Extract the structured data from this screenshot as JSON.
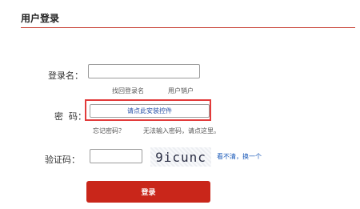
{
  "page": {
    "title": "用户登录"
  },
  "username": {
    "label": "登录名：",
    "value": "",
    "links": {
      "find": "找回登录名",
      "cancel": "用户销户"
    }
  },
  "password": {
    "label": "密  码：",
    "install_button": "请点此安装控件",
    "links": {
      "forgot": "忘记密码？",
      "cannot_input": "无法输入密码，请点这里。"
    }
  },
  "captcha": {
    "label": "验证码：",
    "value": "",
    "image_text": "9icunc",
    "refresh_link": "看不清，换一个"
  },
  "login_button": "登录",
  "colors": {
    "accent": "#c9261a",
    "highlight": "#e23b3b",
    "link": "#1a59b8"
  }
}
